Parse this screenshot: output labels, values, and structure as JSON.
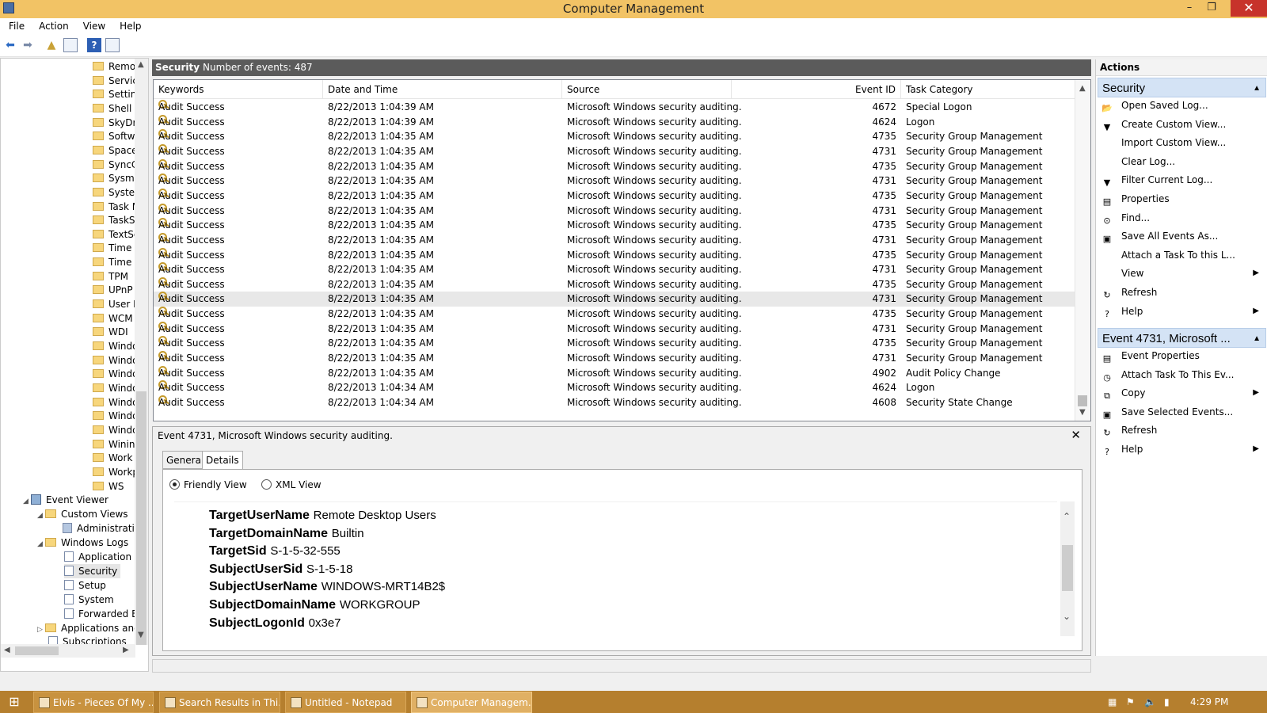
{
  "window": {
    "title": "Computer Management",
    "min": "–",
    "max": "❐",
    "close": "✕"
  },
  "menu": [
    "File",
    "Action",
    "View",
    "Help"
  ],
  "tree": {
    "folders": [
      "Remo",
      "Servic",
      "Settin",
      "Shell",
      "SkyDr",
      "Softw",
      "Space",
      "SyncC",
      "Sysma",
      "Syster",
      "Task M",
      "TaskS",
      "TextSe",
      "Time",
      "Time",
      "TPM",
      "UPnP",
      "User P",
      "WCM",
      "WDI",
      "Windo",
      "Windo",
      "Windo",
      "Windo",
      "Windo",
      "Windo",
      "Windo",
      "Winin",
      "Work",
      "Workp",
      "WS"
    ],
    "event_viewer": "Event Viewer",
    "custom_views": "Custom Views",
    "administrative": "Administrativ",
    "windows_logs": "Windows Logs",
    "logs": [
      "Application",
      "Security",
      "Setup",
      "System",
      "Forwarded Ev"
    ],
    "apps": "Applications and",
    "subscriptions": "Subscriptions"
  },
  "center": {
    "log_name": "Security",
    "count_text": "Number of events: 487"
  },
  "grid": {
    "columns": [
      "Keywords",
      "Date and Time",
      "Source",
      "Event ID",
      "Task Category"
    ],
    "rows": [
      [
        "Audit Success",
        "8/22/2013 1:04:39 AM",
        "Microsoft Windows security auditing.",
        "4672",
        "Special Logon"
      ],
      [
        "Audit Success",
        "8/22/2013 1:04:39 AM",
        "Microsoft Windows security auditing.",
        "4624",
        "Logon"
      ],
      [
        "Audit Success",
        "8/22/2013 1:04:35 AM",
        "Microsoft Windows security auditing.",
        "4735",
        "Security Group Management"
      ],
      [
        "Audit Success",
        "8/22/2013 1:04:35 AM",
        "Microsoft Windows security auditing.",
        "4731",
        "Security Group Management"
      ],
      [
        "Audit Success",
        "8/22/2013 1:04:35 AM",
        "Microsoft Windows security auditing.",
        "4735",
        "Security Group Management"
      ],
      [
        "Audit Success",
        "8/22/2013 1:04:35 AM",
        "Microsoft Windows security auditing.",
        "4731",
        "Security Group Management"
      ],
      [
        "Audit Success",
        "8/22/2013 1:04:35 AM",
        "Microsoft Windows security auditing.",
        "4735",
        "Security Group Management"
      ],
      [
        "Audit Success",
        "8/22/2013 1:04:35 AM",
        "Microsoft Windows security auditing.",
        "4731",
        "Security Group Management"
      ],
      [
        "Audit Success",
        "8/22/2013 1:04:35 AM",
        "Microsoft Windows security auditing.",
        "4735",
        "Security Group Management"
      ],
      [
        "Audit Success",
        "8/22/2013 1:04:35 AM",
        "Microsoft Windows security auditing.",
        "4731",
        "Security Group Management"
      ],
      [
        "Audit Success",
        "8/22/2013 1:04:35 AM",
        "Microsoft Windows security auditing.",
        "4735",
        "Security Group Management"
      ],
      [
        "Audit Success",
        "8/22/2013 1:04:35 AM",
        "Microsoft Windows security auditing.",
        "4731",
        "Security Group Management"
      ],
      [
        "Audit Success",
        "8/22/2013 1:04:35 AM",
        "Microsoft Windows security auditing.",
        "4735",
        "Security Group Management"
      ],
      [
        "Audit Success",
        "8/22/2013 1:04:35 AM",
        "Microsoft Windows security auditing.",
        "4731",
        "Security Group Management"
      ],
      [
        "Audit Success",
        "8/22/2013 1:04:35 AM",
        "Microsoft Windows security auditing.",
        "4735",
        "Security Group Management"
      ],
      [
        "Audit Success",
        "8/22/2013 1:04:35 AM",
        "Microsoft Windows security auditing.",
        "4731",
        "Security Group Management"
      ],
      [
        "Audit Success",
        "8/22/2013 1:04:35 AM",
        "Microsoft Windows security auditing.",
        "4735",
        "Security Group Management"
      ],
      [
        "Audit Success",
        "8/22/2013 1:04:35 AM",
        "Microsoft Windows security auditing.",
        "4731",
        "Security Group Management"
      ],
      [
        "Audit Success",
        "8/22/2013 1:04:35 AM",
        "Microsoft Windows security auditing.",
        "4902",
        "Audit Policy Change"
      ],
      [
        "Audit Success",
        "8/22/2013 1:04:34 AM",
        "Microsoft Windows security auditing.",
        "4624",
        "Logon"
      ],
      [
        "Audit Success",
        "8/22/2013 1:04:34 AM",
        "Microsoft Windows security auditing.",
        "4608",
        "Security State Change"
      ]
    ],
    "selected_row": 13
  },
  "detail": {
    "title": "Event 4731, Microsoft Windows security auditing.",
    "close": "✕",
    "tabs": [
      "General",
      "Details"
    ],
    "radio_friendly": "Friendly View",
    "radio_xml": "XML View",
    "fields": [
      [
        "TargetUserName",
        "Remote Desktop Users"
      ],
      [
        "TargetDomainName",
        "Builtin"
      ],
      [
        "TargetSid",
        "S-1-5-32-555"
      ],
      [
        "SubjectUserSid",
        "S-1-5-18"
      ],
      [
        "SubjectUserName",
        "WINDOWS-MRT14B2$"
      ],
      [
        "SubjectDomainName",
        "WORKGROUP"
      ],
      [
        "SubjectLogonId",
        "0x3e7"
      ]
    ]
  },
  "actions": {
    "title": "Actions",
    "section1": "Security",
    "items1": [
      {
        "label": "Open Saved Log...",
        "icon": "folder-open-icon",
        "glyph": "📂"
      },
      {
        "label": "Create Custom View...",
        "icon": "filter-icon",
        "glyph": "▼"
      },
      {
        "label": "Import Custom View...",
        "icon": "",
        "glyph": ""
      },
      {
        "label": "Clear Log...",
        "icon": "",
        "glyph": ""
      },
      {
        "label": "Filter Current Log...",
        "icon": "filter-icon",
        "glyph": "▼"
      },
      {
        "label": "Properties",
        "icon": "properties-icon",
        "glyph": "▤"
      },
      {
        "label": "Find...",
        "icon": "binoculars-icon",
        "glyph": "⊙"
      },
      {
        "label": "Save All Events As...",
        "icon": "save-icon",
        "glyph": "▣"
      },
      {
        "label": "Attach a Task To this L...",
        "icon": "",
        "glyph": ""
      },
      {
        "label": "View",
        "icon": "",
        "glyph": "",
        "submenu": true
      },
      {
        "label": "Refresh",
        "icon": "refresh-icon",
        "glyph": "↻"
      },
      {
        "label": "Help",
        "icon": "help-icon",
        "glyph": "?",
        "submenu": true
      }
    ],
    "section2": "Event 4731, Microsoft ...",
    "items2": [
      {
        "label": "Event Properties",
        "icon": "properties-icon",
        "glyph": "▤"
      },
      {
        "label": "Attach Task To This Ev...",
        "icon": "task-icon",
        "glyph": "◷"
      },
      {
        "label": "Copy",
        "icon": "copy-icon",
        "glyph": "⧉",
        "submenu": true
      },
      {
        "label": "Save Selected Events...",
        "icon": "save-icon",
        "glyph": "▣"
      },
      {
        "label": "Refresh",
        "icon": "refresh-icon",
        "glyph": "↻"
      },
      {
        "label": "Help",
        "icon": "help-icon",
        "glyph": "?",
        "submenu": true
      }
    ]
  },
  "taskbar": {
    "tasks": [
      "Elvis - Pieces Of My ...",
      "Search Results in Thi...",
      "Untitled - Notepad",
      "Computer Managem..."
    ],
    "clock": "4:29 PM"
  },
  "colors": {
    "titlebar": "#f2c365",
    "taskbar": "#b57f2e",
    "section": "#d4e3f5",
    "header": "#5b5b5b"
  }
}
